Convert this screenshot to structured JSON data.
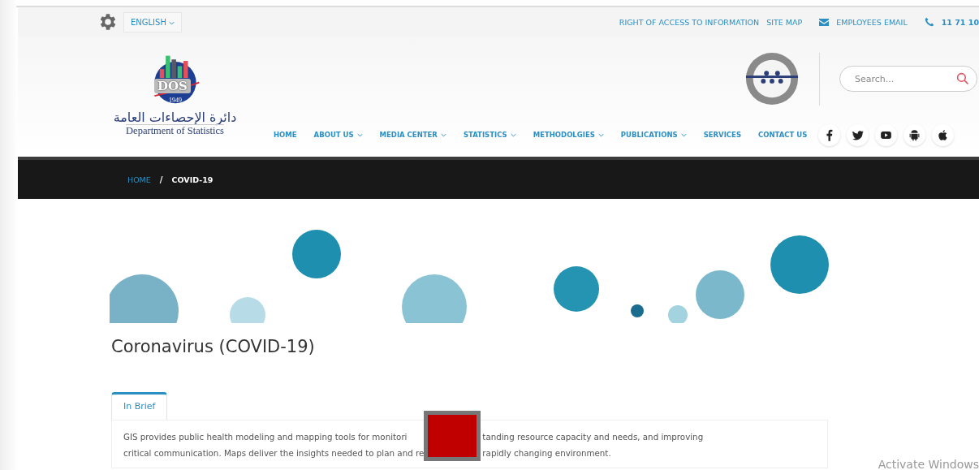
{
  "top_bar": {
    "language": "ENGLISH",
    "links": [
      {
        "label": "RIGHT OF ACCESS TO INFORMATION",
        "kind": "text"
      },
      {
        "label": "SITE MAP",
        "kind": "text"
      },
      {
        "label": "EMPLOYEES EMAIL",
        "kind": "email"
      },
      {
        "label": "11 71 10",
        "kind": "phone"
      }
    ]
  },
  "logo": {
    "badge": "DOS",
    "year": "1949",
    "arabic_name": "دائرة الإحصاءات العامة",
    "english_name": "Department of Statistics"
  },
  "search": {
    "placeholder": "Search..."
  },
  "nav": [
    {
      "label": "HOME",
      "dropdown": false
    },
    {
      "label": "ABOUT US",
      "dropdown": true
    },
    {
      "label": "MEDIA CENTER",
      "dropdown": true
    },
    {
      "label": "STATISTICS",
      "dropdown": true
    },
    {
      "label": "METHODOLGIES",
      "dropdown": true
    },
    {
      "label": "PUBLICATIONS",
      "dropdown": true
    },
    {
      "label": "SERVICES",
      "dropdown": false
    },
    {
      "label": "CONTACT US",
      "dropdown": false
    }
  ],
  "social": [
    {
      "kind": "facebook"
    },
    {
      "kind": "twitter"
    },
    {
      "kind": "youtube"
    },
    {
      "kind": "android"
    },
    {
      "kind": "apple"
    }
  ],
  "breadcrumb": {
    "items": [
      "HOME",
      "COVID-19"
    ],
    "separator": "/"
  },
  "page_title": "Coronavirus (COVID-19)",
  "tabs": [
    {
      "label": "In Brief",
      "selected": true
    }
  ],
  "brief_lines": [
    {
      "left": "GIS provides public health modeling and mapping tools for monitori",
      "right": "tanding resource capacity and needs, and improving"
    },
    {
      "left": "critical communication. Maps deliver the insights needed to plan and re",
      "right": "rapidly changing environment."
    }
  ],
  "overlay_block": {
    "color": "#c00000"
  },
  "os_watermark": "Activate Windows"
}
